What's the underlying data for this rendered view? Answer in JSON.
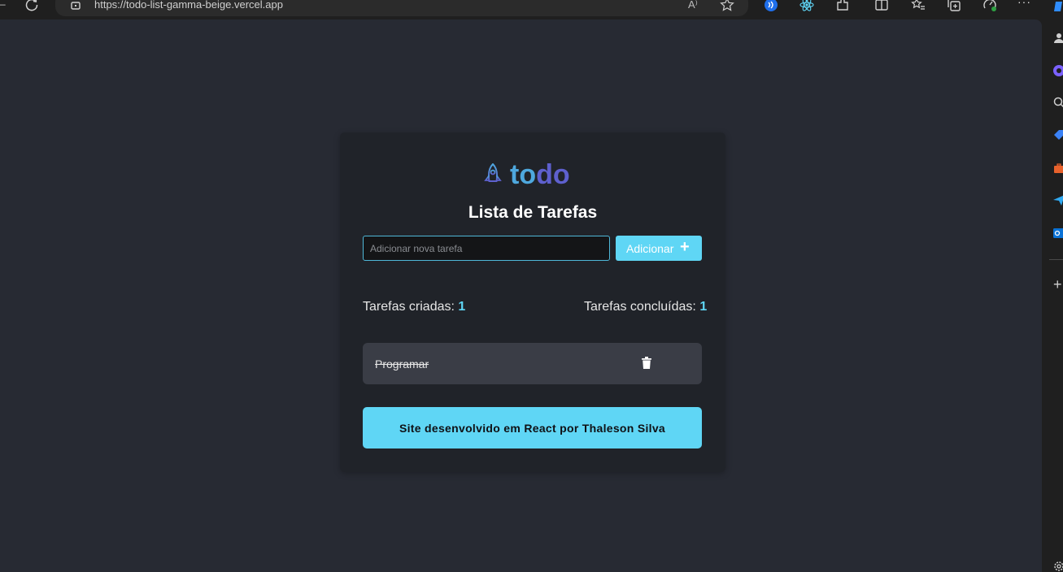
{
  "browser": {
    "url": "https://todo-list-gamma-beige.vercel.app",
    "read_aloud_label": "A⁾",
    "more_menu_glyph": "···",
    "new_sidebar_item_glyph": "+",
    "icons": [
      "refresh-icon",
      "lock-icon",
      "read-aloud-icon",
      "favorite-star-icon",
      "media-icon",
      "react-devtools-icon",
      "extensions-icon",
      "split-screen-icon",
      "favorites-icon",
      "collections-icon",
      "performance-icon",
      "more-icon"
    ]
  },
  "app": {
    "logo": {
      "part1": "to",
      "part2": "do",
      "icon": "rocket-icon"
    },
    "title": "Lista de Tarefas",
    "input_placeholder": "Adicionar nova tarefa",
    "add_button_label": "Adicionar",
    "add_button_icon": "+",
    "stats": {
      "created_label": "Tarefas criadas:",
      "created_count": "1",
      "done_label": "Tarefas concluídas:",
      "done_count": "1"
    },
    "tasks": [
      {
        "text": "Programar",
        "completed": true
      }
    ],
    "footer": "Site desenvolvido em React por Thaleson Silva"
  },
  "colors": {
    "accent": "#5fd6f5",
    "background": "#272a33",
    "card": "#202329",
    "task_bg": "#3a3d46",
    "logo_to": "#4ea8de",
    "logo_do": "#5e60ce"
  }
}
